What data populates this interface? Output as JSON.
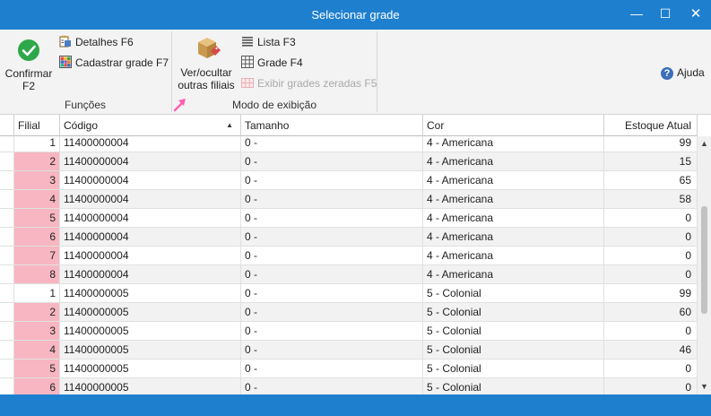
{
  "window": {
    "title": "Selecionar grade",
    "minimize": "—",
    "maximize": "☐",
    "close": "✕"
  },
  "ribbon": {
    "confirm": {
      "line1": "Confirmar",
      "line2": "F2",
      "icon": "check-circle-icon"
    },
    "details": {
      "label": "Detalhes F6",
      "icon": "clipboard-icon"
    },
    "register_grid": {
      "label": "Cadastrar grade F7",
      "icon": "color-grid-icon"
    },
    "funcoes_label": "Funções",
    "toggle_branches": {
      "line1": "Ver/ocultar",
      "line2": "outras filiais",
      "icon": "box-tag-icon"
    },
    "list": {
      "label": "Lista F3",
      "icon": "list-icon"
    },
    "grid": {
      "label": "Grade F4",
      "icon": "table-icon"
    },
    "show_zeroed": {
      "label": "Exibir grades zeradas F5",
      "icon": "zero-grid-icon",
      "disabled": true
    },
    "view_mode_label": "Modo de exibição",
    "help": {
      "label": "Ajuda",
      "glyph": "?"
    }
  },
  "grid": {
    "columns": [
      "Filial",
      "Código",
      "Tamanho",
      "Cor",
      "Estoque Atual"
    ],
    "sort_indicator": "▲",
    "rows": [
      {
        "filial": "1",
        "codigo": "11400000004",
        "tamanho": "0 -",
        "cor": "4 - Americana",
        "estoque": "99",
        "highlight": false
      },
      {
        "filial": "2",
        "codigo": "11400000004",
        "tamanho": "0 -",
        "cor": "4 - Americana",
        "estoque": "15",
        "highlight": true
      },
      {
        "filial": "3",
        "codigo": "11400000004",
        "tamanho": "0 -",
        "cor": "4 - Americana",
        "estoque": "65",
        "highlight": true
      },
      {
        "filial": "4",
        "codigo": "11400000004",
        "tamanho": "0 -",
        "cor": "4 - Americana",
        "estoque": "58",
        "highlight": true
      },
      {
        "filial": "5",
        "codigo": "11400000004",
        "tamanho": "0 -",
        "cor": "4 - Americana",
        "estoque": "0",
        "highlight": true
      },
      {
        "filial": "6",
        "codigo": "11400000004",
        "tamanho": "0 -",
        "cor": "4 - Americana",
        "estoque": "0",
        "highlight": true
      },
      {
        "filial": "7",
        "codigo": "11400000004",
        "tamanho": "0 -",
        "cor": "4 - Americana",
        "estoque": "0",
        "highlight": true
      },
      {
        "filial": "8",
        "codigo": "11400000004",
        "tamanho": "0 -",
        "cor": "4 - Americana",
        "estoque": "0",
        "highlight": true
      },
      {
        "filial": "1",
        "codigo": "11400000005",
        "tamanho": "0 -",
        "cor": "5 - Colonial",
        "estoque": "99",
        "highlight": false
      },
      {
        "filial": "2",
        "codigo": "11400000005",
        "tamanho": "0 -",
        "cor": "5 - Colonial",
        "estoque": "60",
        "highlight": true
      },
      {
        "filial": "3",
        "codigo": "11400000005",
        "tamanho": "0 -",
        "cor": "5 - Colonial",
        "estoque": "0",
        "highlight": true
      },
      {
        "filial": "4",
        "codigo": "11400000005",
        "tamanho": "0 -",
        "cor": "5 - Colonial",
        "estoque": "46",
        "highlight": true
      },
      {
        "filial": "5",
        "codigo": "11400000005",
        "tamanho": "0 -",
        "cor": "5 - Colonial",
        "estoque": "0",
        "highlight": true
      },
      {
        "filial": "6",
        "codigo": "11400000005",
        "tamanho": "0 -",
        "cor": "5 - Colonial",
        "estoque": "0",
        "highlight": true
      }
    ]
  },
  "colors": {
    "accent": "#1f7fcf",
    "highlight": "#f7b6c1",
    "check_green": "#2ea84a",
    "help_blue": "#3b6fb6"
  }
}
